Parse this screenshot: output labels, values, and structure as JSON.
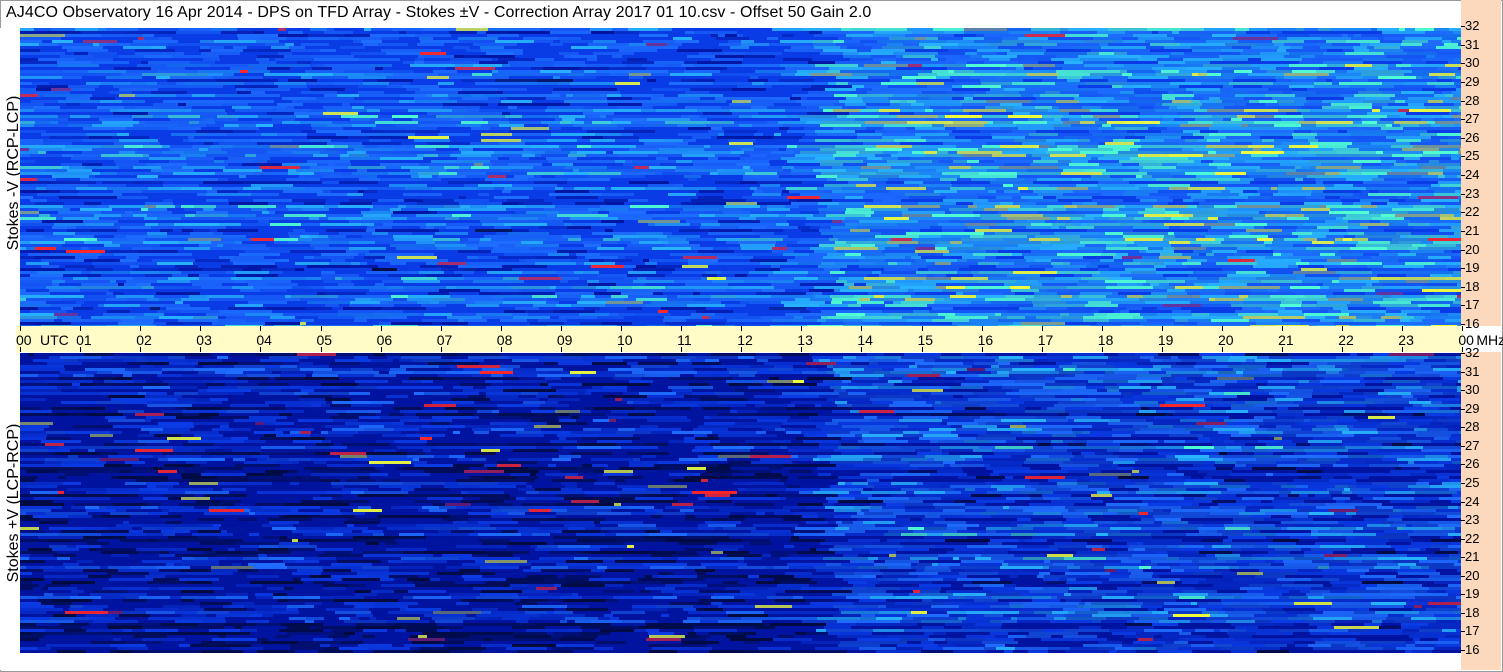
{
  "title": "AJ4CO Observatory  16 Apr 2014  -  DPS on TFD Array  -  Stokes ±V  -  Correction Array 2017 01 10.csv  -  Offset 50  Gain 2.0",
  "panels": {
    "top_label": "Stokes -V (RCP-LCP)",
    "bottom_label": "Stokes +V (LCP-RCP)"
  },
  "time_axis": {
    "labels": [
      "00",
      "UTC",
      "01",
      "02",
      "03",
      "04",
      "05",
      "06",
      "07",
      "08",
      "09",
      "10",
      "11",
      "12",
      "13",
      "14",
      "15",
      "16",
      "17",
      "18",
      "19",
      "20",
      "21",
      "22",
      "23",
      "00",
      "MHz"
    ]
  },
  "freq_labels": [
    "32",
    "31",
    "30",
    "29",
    "28",
    "27",
    "26",
    "25",
    "24",
    "23",
    "22",
    "21",
    "20",
    "19",
    "18",
    "17",
    "16"
  ],
  "colors": {
    "axis_band": "#fffcc8",
    "right_panel": "#fcd9bd",
    "colormap": [
      "#000a3c",
      "#0014a0",
      "#0a3ce6",
      "#1e6eff",
      "#28b4ff",
      "#50ffd2",
      "#f0ff3c",
      "#ff2828"
    ]
  },
  "chart_data": {
    "type": "heatmap",
    "title": "AJ4CO Observatory  16 Apr 2014  -  DPS on TFD Array  -  Stokes ±V  -  Correction Array 2017 01 10.csv  -  Offset 50  Gain 2.0",
    "x": {
      "label": "UTC",
      "ticks": [
        "00",
        "01",
        "02",
        "03",
        "04",
        "05",
        "06",
        "07",
        "08",
        "09",
        "10",
        "11",
        "12",
        "13",
        "14",
        "15",
        "16",
        "17",
        "18",
        "19",
        "20",
        "21",
        "22",
        "23",
        "00"
      ],
      "range_hours": [
        0,
        24
      ]
    },
    "y": {
      "label": "MHz",
      "ticks": [
        32,
        31,
        30,
        29,
        28,
        27,
        26,
        25,
        24,
        23,
        22,
        21,
        20,
        19,
        18,
        17,
        16
      ],
      "range_mhz": [
        16,
        32
      ]
    },
    "panels": [
      "Stokes -V (RCP-LCP)",
      "Stokes +V (LCP-RCP)"
    ]
  }
}
